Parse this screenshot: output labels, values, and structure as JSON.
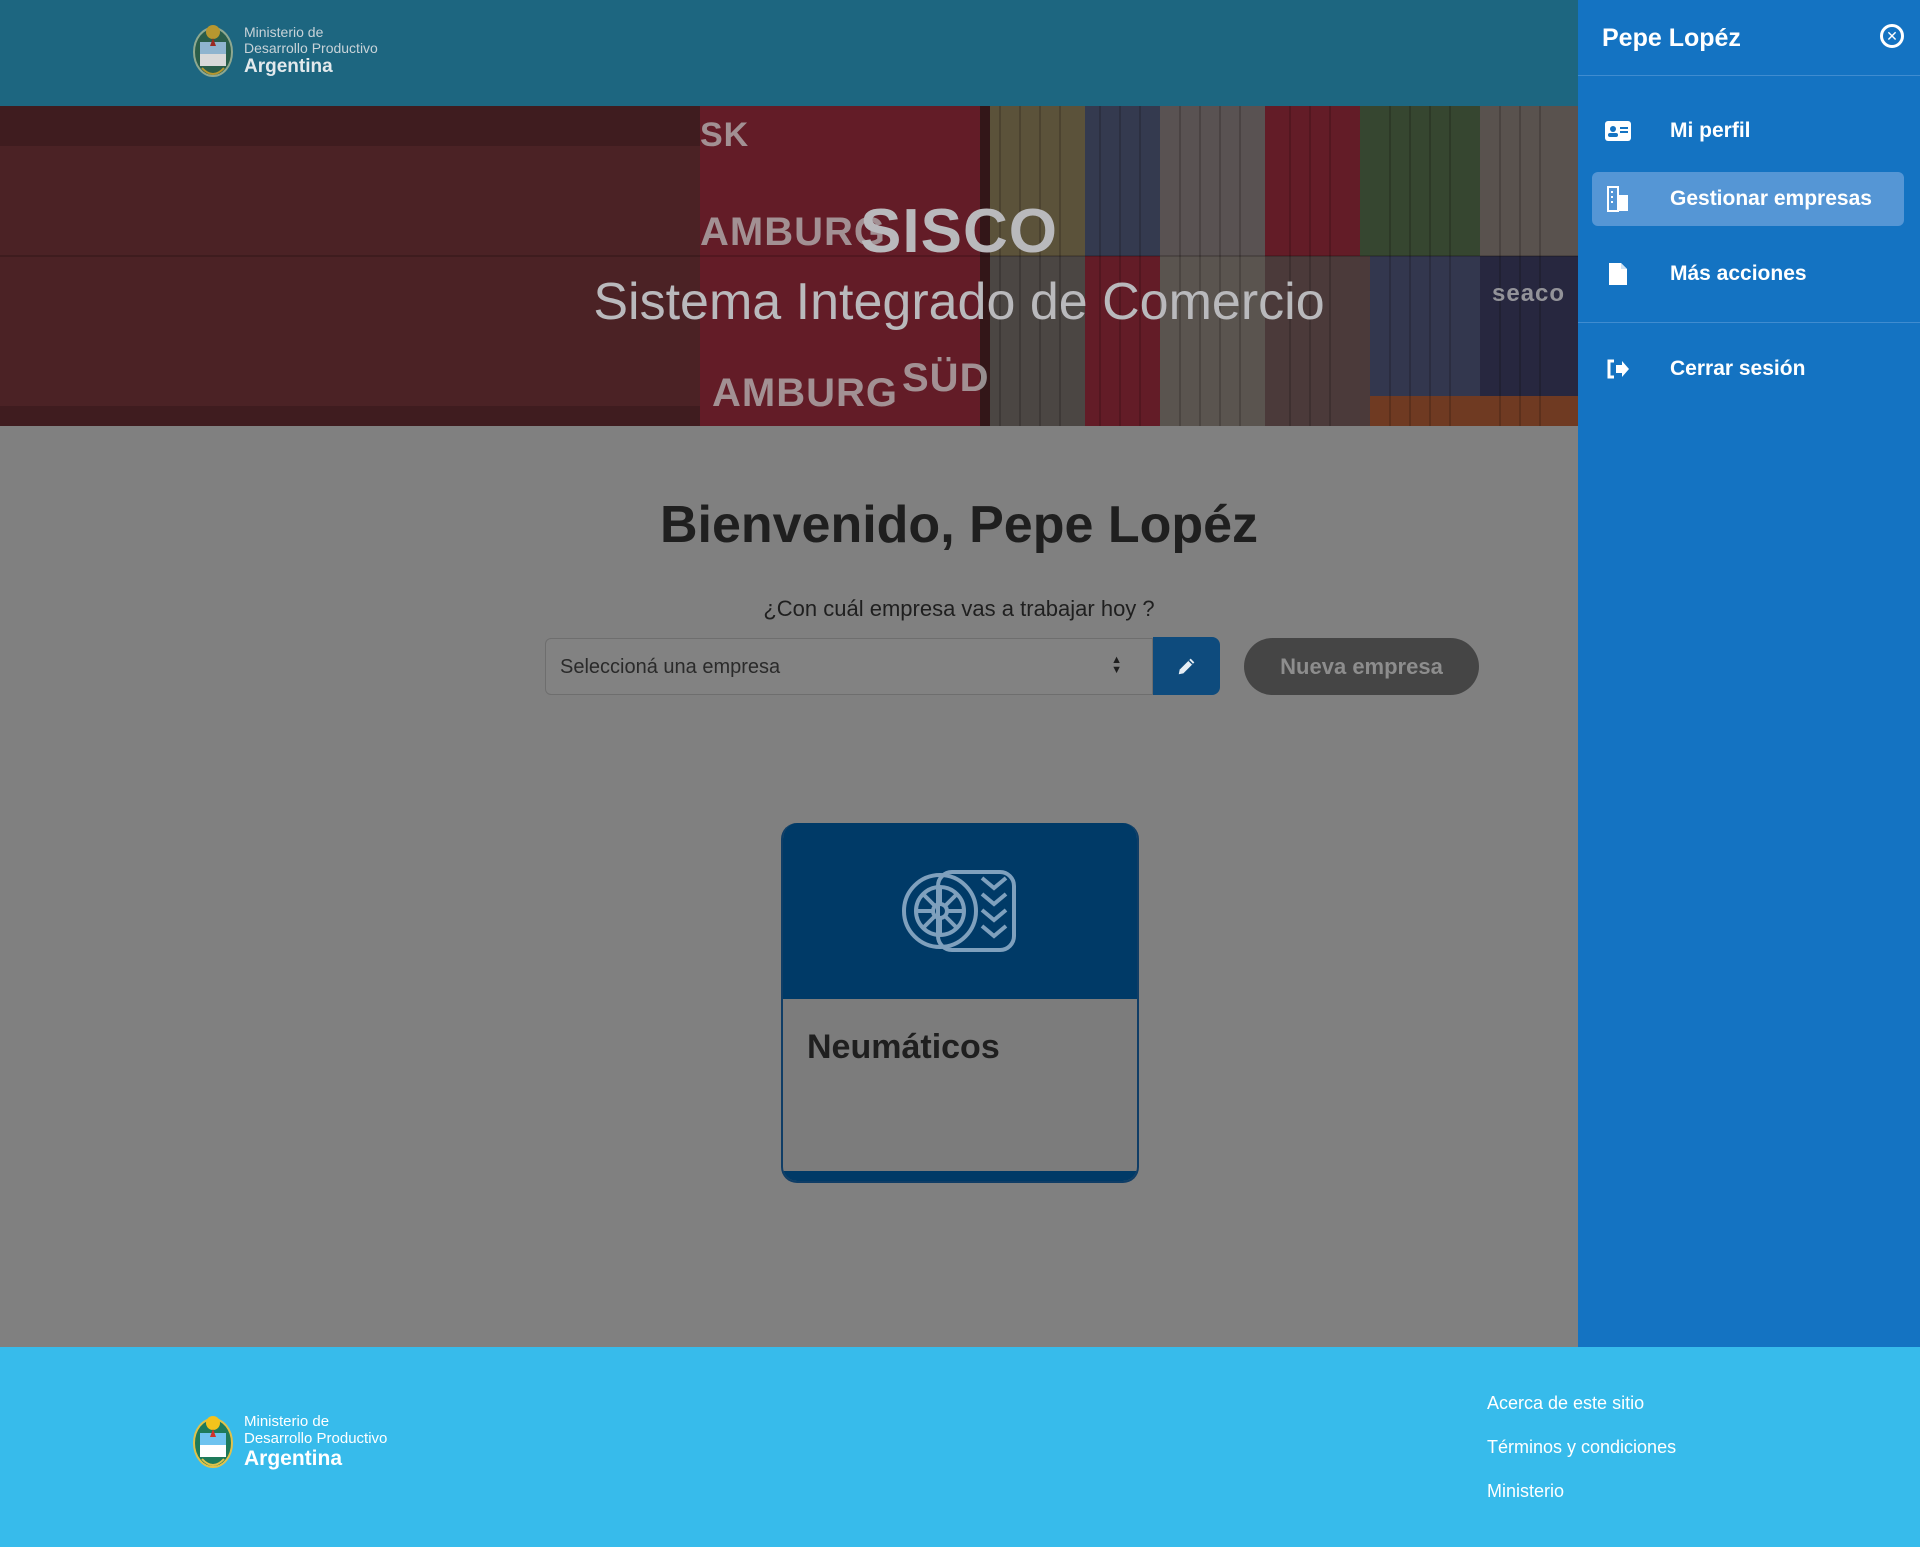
{
  "header": {
    "brand": {
      "line1": "Ministerio de",
      "line2": "Desarrollo Productivo",
      "line3": "Argentina"
    }
  },
  "hero": {
    "title": "SISCO",
    "subtitle": "Sistema Integrado de Comercio",
    "bg_stamps": [
      "AMBURG",
      "AMBURG",
      "SÜD",
      "SK",
      "seaco"
    ]
  },
  "main": {
    "welcome": "Bienvenido, Pepe Lopéz",
    "question": "¿Con cuál empresa vas a trabajar hoy ?",
    "select_value": "Seleccioná una empresa",
    "new_company_label": "Nueva empresa",
    "card": {
      "name": "Neumáticos",
      "icon": "tire-icon"
    }
  },
  "sidebar": {
    "user_name": "Pepe Lopéz",
    "items": [
      {
        "label": "Mi perfil",
        "icon": "id-card-icon",
        "active": false
      },
      {
        "label": "Gestionar empresas",
        "icon": "building-icon",
        "active": true
      },
      {
        "label": "Más acciones",
        "icon": "file-icon",
        "active": false
      },
      {
        "label": "Cerrar sesión",
        "icon": "sign-out-icon",
        "active": false
      }
    ]
  },
  "footer": {
    "brand": {
      "line1": "Ministerio de",
      "line2": "Desarrollo Productivo",
      "line3": "Argentina"
    },
    "links": [
      "Acerca de este sitio",
      "Términos y condiciones",
      "Ministerio"
    ]
  },
  "colors": {
    "header_bg": "#1d6680",
    "sidebar_bg": "#1473c2",
    "sidebar_active": "#5596d5",
    "footer_bg": "#37bbeb",
    "card_top": "#003a67",
    "overlay_gray": "#808080"
  }
}
